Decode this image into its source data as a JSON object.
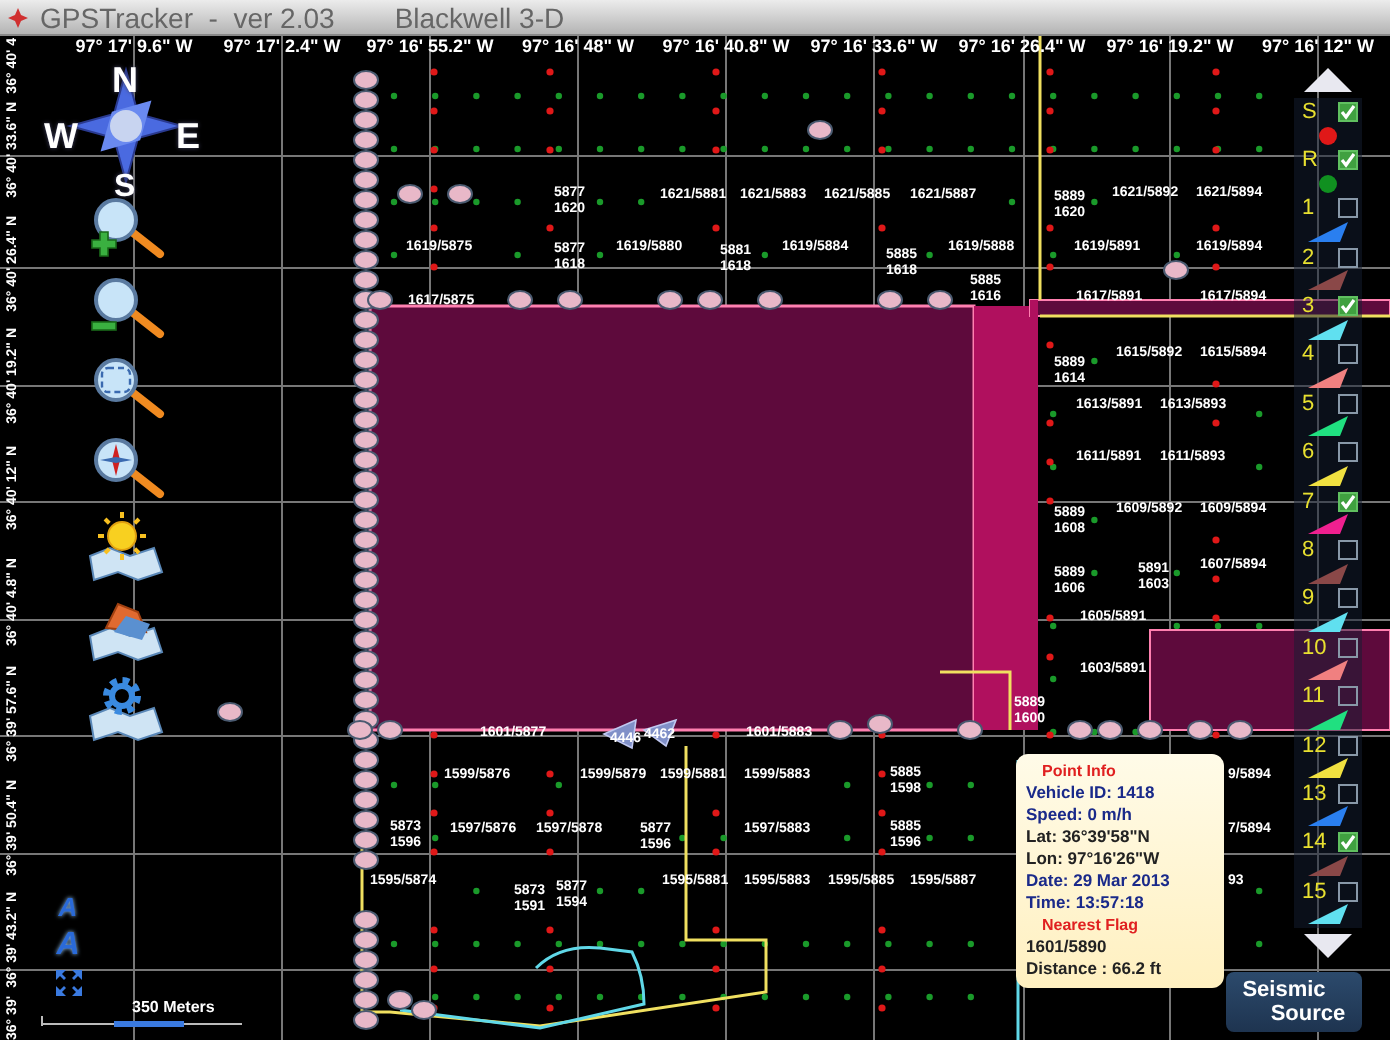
{
  "window": {
    "title": "GPSTracker  -  ver 2.03",
    "project": "Blackwell 3-D"
  },
  "longitudes": [
    "97° 17' 9.6\" W",
    "97° 17' 2.4\" W",
    "97° 16' 55.2\" W",
    "97° 16' 48\" W",
    "97° 16' 40.8\" W",
    "97° 16' 33.6\" W",
    "97° 16' 26.4\" W",
    "97° 16' 19.2\" W",
    "97° 16' 12\" W"
  ],
  "latitudes": [
    "36° 40' 4",
    "36° 40' 33.6\" N",
    "36° 40' 26.4\" N",
    "36° 40' 19.2\" N",
    "36° 40' 12\" N",
    "36° 40' 4.8\" N",
    "36° 39' 57.6\" N",
    "36° 39' 50.4\" N",
    "36° 39' 43.2\" N",
    "36° 39'"
  ],
  "toolbar": {
    "compass": {
      "north": "N",
      "east": "E",
      "south": "S",
      "west": "W"
    },
    "tools": [
      {
        "kind": "zoom-in"
      },
      {
        "kind": "zoom-out"
      },
      {
        "kind": "zoom-extent"
      },
      {
        "kind": "zoom-center"
      },
      {
        "kind": "map-sun"
      },
      {
        "kind": "map-layers"
      },
      {
        "kind": "map-settings"
      }
    ],
    "bottom_tools": [
      {
        "kind": "font",
        "label": "A"
      },
      {
        "kind": "font",
        "label": "A"
      },
      {
        "kind": "expand"
      }
    ]
  },
  "flag_labels": [
    "5877\n1620",
    "1621/5881",
    "1621/5883",
    "1621/5885",
    "1621/5887",
    "5889\n1620",
    "1621/5892",
    "1621/5894",
    "1619/5875",
    "5877\n1618",
    "1619/5880",
    "5881\n1618",
    "1619/5884",
    "5885\n1618",
    "1619/5888",
    "1619/5891",
    "1619/5894",
    "1617/5875",
    "5885\n1616",
    "1617/5891",
    "1617/5894",
    "5889\n1614",
    "1615/5892",
    "1615/5894",
    "1613/5891",
    "1613/5893",
    "1611/5891",
    "1611/5893",
    "5889\n1608",
    "1609/5892",
    "1609/5894",
    "5889\n1606",
    "5891\n1603",
    "1607/5894",
    "1605/5891",
    "1603/5891",
    "5889\n1600",
    "1601/5877",
    "4446",
    "4462",
    "1601/5883",
    "1599/5876",
    "1599/5879",
    "1599/5881",
    "1599/5883",
    "5885\n1598",
    "9/5894",
    "5873\n1596",
    "1597/5876",
    "1597/5878",
    "5877\n1596",
    "1597/5883",
    "5885\n1596",
    "7/5894",
    "1595/5874",
    "5873\n1591",
    "5877\n1594",
    "1595/5881",
    "1595/5883",
    "1595/5885",
    "1595/5887",
    "93"
  ],
  "point_info": {
    "rows": [
      {
        "kind": "heading",
        "text": "Point Info"
      },
      {
        "kind": "info",
        "text": "Vehicle ID: 1418"
      },
      {
        "kind": "info",
        "text": "Speed: 0 m/h"
      },
      {
        "kind": "plain",
        "text": "Lat: 36°39'58\"N"
      },
      {
        "kind": "plain",
        "text": "Lon: 97°16'26\"W"
      },
      {
        "kind": "info",
        "text": "Date: 29 Mar 2013"
      },
      {
        "kind": "info",
        "text": "Time: 13:57:18"
      },
      {
        "kind": "heading",
        "text": "Nearest Flag"
      },
      {
        "kind": "plain",
        "text": "1601/5890"
      },
      {
        "kind": "plain",
        "text": "Distance : 66.2 ft"
      }
    ]
  },
  "legend": {
    "items": [
      {
        "label": "S",
        "kind": "dot",
        "checked": true,
        "color": "#e01818"
      },
      {
        "label": "R",
        "kind": "dot",
        "checked": true,
        "color": "#109020"
      },
      {
        "label": "1",
        "kind": "triangle",
        "checked": false,
        "color": "#2a7ff0"
      },
      {
        "label": "2",
        "kind": "triangle",
        "checked": false,
        "color": "#8a4848"
      },
      {
        "label": "3",
        "kind": "triangle",
        "checked": true,
        "color": "#60e0f0"
      },
      {
        "label": "4",
        "kind": "triangle",
        "checked": false,
        "color": "#f08080"
      },
      {
        "label": "5",
        "kind": "triangle",
        "checked": false,
        "color": "#20e080"
      },
      {
        "label": "6",
        "kind": "triangle",
        "checked": false,
        "color": "#f0e040"
      },
      {
        "label": "7",
        "kind": "triangle",
        "checked": true,
        "color": "#f02090"
      },
      {
        "label": "8",
        "kind": "triangle",
        "checked": false,
        "color": "#8a4848"
      },
      {
        "label": "9",
        "kind": "triangle",
        "checked": false,
        "color": "#60e0f0"
      },
      {
        "label": "10",
        "kind": "triangle",
        "checked": false,
        "color": "#f08080"
      },
      {
        "label": "11",
        "kind": "triangle",
        "checked": false,
        "color": "#20e080"
      },
      {
        "label": "12",
        "kind": "triangle",
        "checked": false,
        "color": "#f0e040"
      },
      {
        "label": "13",
        "kind": "triangle",
        "checked": false,
        "color": "#2a7ff0"
      },
      {
        "label": "14",
        "kind": "triangle",
        "checked": true,
        "color": "#8a4848"
      },
      {
        "label": "15",
        "kind": "triangle",
        "checked": false,
        "color": "#60e0f0"
      }
    ]
  },
  "logo": {
    "line1": "Seismic",
    "line2": "Source"
  },
  "scale": {
    "label": "350 Meters"
  }
}
